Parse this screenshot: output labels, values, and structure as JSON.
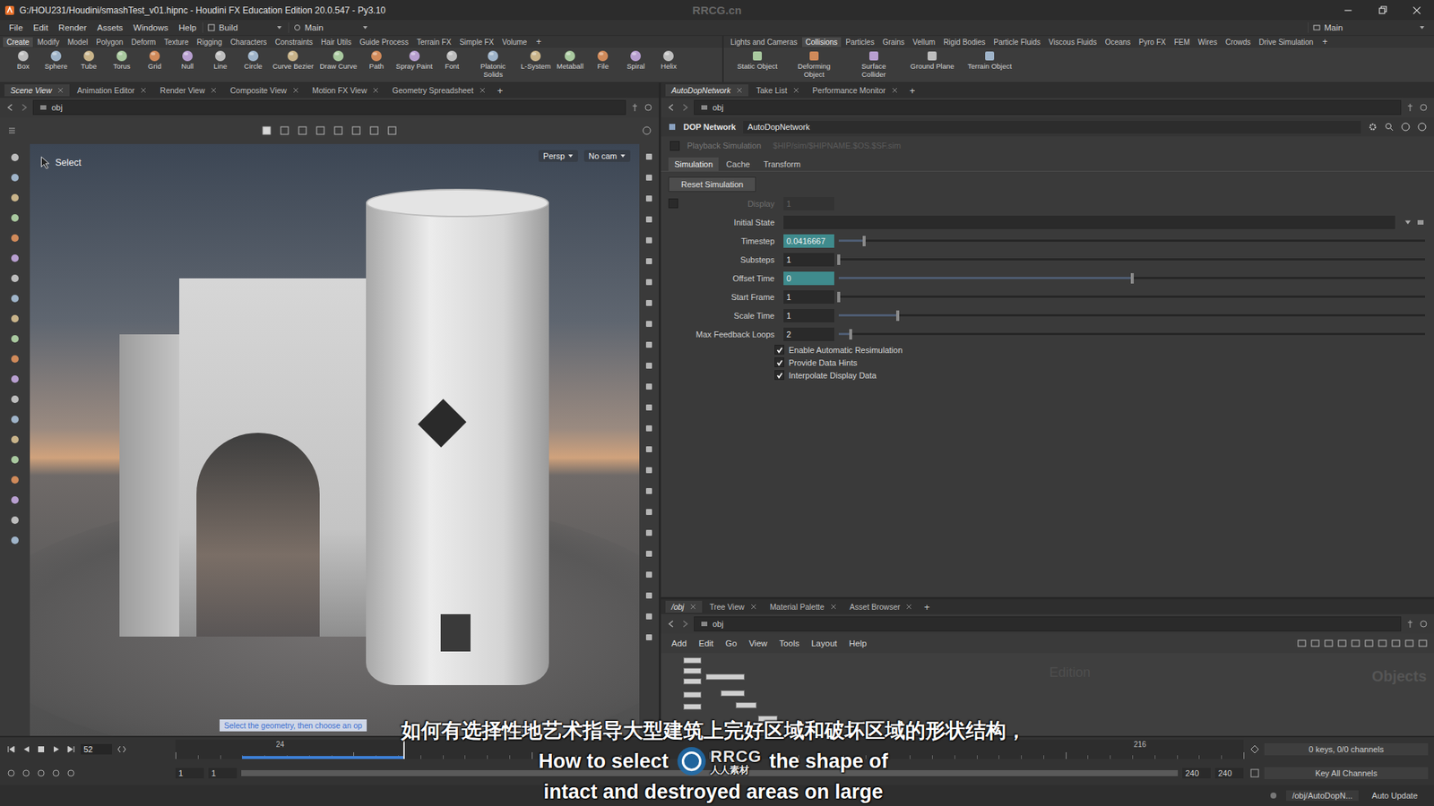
{
  "window": {
    "title": "G:/HOU231/Houdini/smashTest_v01.hipnc - Houdini FX Education Edition 20.0.547 - Py3.10",
    "watermark": "RRCG.cn"
  },
  "menubar": {
    "items": [
      "File",
      "Edit",
      "Render",
      "Assets",
      "Windows",
      "Help"
    ],
    "desktop": "Build",
    "workspace": "Main",
    "right_workspace": "Main"
  },
  "shelf_left": {
    "tabs": [
      {
        "label": "Create",
        "selected": true
      },
      {
        "label": "Modify",
        "selected": false
      },
      {
        "label": "Model",
        "selected": false
      },
      {
        "label": "Polygon",
        "selected": false
      },
      {
        "label": "Deform",
        "selected": false
      },
      {
        "label": "Texture",
        "selected": false
      },
      {
        "label": "Rigging",
        "selected": false
      },
      {
        "label": "Characters",
        "selected": false
      },
      {
        "label": "Constraints",
        "selected": false
      },
      {
        "label": "Hair Utils",
        "selected": false
      },
      {
        "label": "Guide Process",
        "selected": false
      },
      {
        "label": "Terrain FX",
        "selected": false
      },
      {
        "label": "Simple FX",
        "selected": false
      },
      {
        "label": "Volume",
        "selected": false
      }
    ],
    "add": "+",
    "tools": [
      "Box",
      "Sphere",
      "Tube",
      "Torus",
      "Grid",
      "Null",
      "Line",
      "Circle",
      "Curve Bezier",
      "Draw Curve",
      "Path",
      "Spray Paint",
      "Font",
      "Platonic Solids",
      "L-System",
      "Metaball",
      "File",
      "Spiral",
      "Helix"
    ]
  },
  "shelf_right": {
    "tabs": [
      {
        "label": "Lights and Cameras",
        "selected": false
      },
      {
        "label": "Collisions",
        "selected": true
      },
      {
        "label": "Particles",
        "selected": false
      },
      {
        "label": "Grains",
        "selected": false
      },
      {
        "label": "Vellum",
        "selected": false
      },
      {
        "label": "Rigid Bodies",
        "selected": false
      },
      {
        "label": "Particle Fluids",
        "selected": false
      },
      {
        "label": "Viscous Fluids",
        "selected": false
      },
      {
        "label": "Oceans",
        "selected": false
      },
      {
        "label": "Pyro FX",
        "selected": false
      },
      {
        "label": "FEM",
        "selected": false
      },
      {
        "label": "Wires",
        "selected": false
      },
      {
        "label": "Crowds",
        "selected": false
      },
      {
        "label": "Drive Simulation",
        "selected": false
      }
    ],
    "add": "+",
    "tools": [
      "Static Object",
      "Deforming Object",
      "Surface Collider",
      "Ground Plane",
      "Terrain Object"
    ]
  },
  "viewport_pane": {
    "tabs": [
      {
        "label": "Scene View",
        "selected": true
      },
      {
        "label": "Animation Editor",
        "selected": false
      },
      {
        "label": "Render View",
        "selected": false
      },
      {
        "label": "Composite View",
        "selected": false
      },
      {
        "label": "Motion FX View",
        "selected": false
      },
      {
        "label": "Geometry Spreadsheet",
        "selected": false
      }
    ],
    "add": "+",
    "path": "obj",
    "mode_label": "Select",
    "view": "Persp",
    "camera": "No cam",
    "hint": "Select the geometry, then choose an op"
  },
  "params_pane": {
    "tabs": [
      {
        "label": "AutoDopNetwork",
        "selected": true
      },
      {
        "label": "Take List",
        "selected": false
      },
      {
        "label": "Performance Monitor",
        "selected": false
      }
    ],
    "add": "+",
    "path": "obj",
    "node_type": "DOP Network",
    "node_name": "AutoDopNetwork",
    "playback": {
      "label": "Playback Simulation",
      "file": "$HIP/sim/$HIPNAME.$OS.$SF.sim",
      "checked": false,
      "disabled": true
    },
    "sections": [
      {
        "label": "Simulation",
        "selected": true
      },
      {
        "label": "Cache",
        "selected": false
      },
      {
        "label": "Transform",
        "selected": false
      }
    ],
    "reset_button": "Reset Simulation",
    "display": {
      "label": "Display",
      "value": "1",
      "checked": false,
      "disabled": true
    },
    "initial_state": {
      "label": "Initial State",
      "value": ""
    },
    "fields": [
      {
        "label": "Timestep",
        "value": "0.0416667",
        "level": 0.043,
        "highlighted": true
      },
      {
        "label": "Substeps",
        "value": "1",
        "level": 0.0,
        "highlighted": false
      },
      {
        "label": "Offset Time",
        "value": "0",
        "level": 0.5,
        "highlighted": true
      },
      {
        "label": "Start Frame",
        "value": "1",
        "level": 0.0,
        "highlighted": false
      },
      {
        "label": "Scale Time",
        "value": "1",
        "level": 0.1,
        "highlighted": false
      },
      {
        "label": "Max Feedback Loops",
        "value": "2",
        "level": 0.02,
        "highlighted": false
      }
    ],
    "toggles": [
      {
        "label": "Enable Automatic Resimulation",
        "checked": true
      },
      {
        "label": "Provide Data Hints",
        "checked": true
      },
      {
        "label": "Interpolate Display Data",
        "checked": true
      }
    ]
  },
  "network_pane": {
    "tabs": [
      {
        "label": "/obj",
        "selected": true
      },
      {
        "label": "Tree View",
        "selected": false
      },
      {
        "label": "Material Palette",
        "selected": false
      },
      {
        "label": "Asset Browser",
        "selected": false
      }
    ],
    "add": "+",
    "path": "obj",
    "menu": [
      "Add",
      "Edit",
      "Go",
      "View",
      "Tools",
      "Layout",
      "Help"
    ],
    "context_label": "Objects",
    "watermark": "Edition"
  },
  "timeline": {
    "frame": "52",
    "ticks": [
      {
        "label": "24",
        "level": 0.098
      },
      {
        "label": "216",
        "level": 0.903
      }
    ],
    "playhead_level": 0.213,
    "cache": {
      "start_level": 0.062,
      "end_level": 0.213
    },
    "range": {
      "start": "1",
      "start2": "1",
      "end": "240",
      "end2": "240",
      "level": 1
    },
    "keys": "0 keys, 0/0 channels",
    "key_all": "Key All Channels",
    "status_path": "/obj/AutoDopN...",
    "update": "Auto Update"
  },
  "subtitles": {
    "zh": "如何有选择性地艺术指导大型建筑上完好区域和破坏区域的形状结构，",
    "en_line1": [
      "How to select",
      "the shape of"
    ],
    "en_line2": "intact and destroyed areas on large"
  },
  "logo": {
    "mark": "RRCG",
    "sub": "人人素材"
  }
}
